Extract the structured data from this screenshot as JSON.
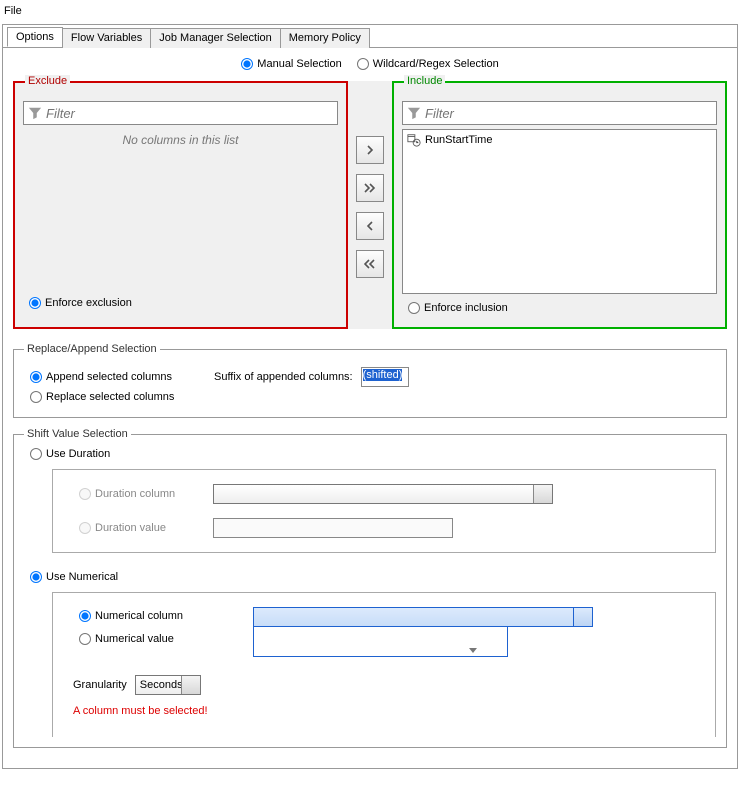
{
  "menu": {
    "file": "File"
  },
  "tabs": {
    "options": "Options",
    "flow_variables": "Flow Variables",
    "job_manager": "Job Manager Selection",
    "memory_policy": "Memory Policy"
  },
  "selection_mode": {
    "manual": "Manual Selection",
    "wildcard": "Wildcard/Regex Selection"
  },
  "exclude": {
    "title": "Exclude",
    "filter_placeholder": "Filter",
    "empty_msg": "No columns in this list",
    "enforce": "Enforce exclusion"
  },
  "include": {
    "title": "Include",
    "filter_placeholder": "Filter",
    "items": [
      "RunStartTime"
    ],
    "enforce": "Enforce inclusion"
  },
  "move": {
    "add": "›",
    "add_all": "»",
    "remove": "‹",
    "remove_all": "«"
  },
  "replace_append": {
    "legend": "Replace/Append Selection",
    "append": "Append selected columns",
    "suffix_label": "Suffix of appended columns:",
    "suffix_value": "(shifted)",
    "replace": "Replace selected columns"
  },
  "shift": {
    "legend": "Shift Value Selection",
    "use_duration": "Use Duration",
    "duration_column": "Duration column",
    "duration_value": "Duration value",
    "use_numerical": "Use Numerical",
    "numerical_column": "Numerical column",
    "numerical_value": "Numerical value",
    "granularity_label": "Granularity",
    "granularity_value": "Seconds",
    "error": "A column must be selected!"
  }
}
